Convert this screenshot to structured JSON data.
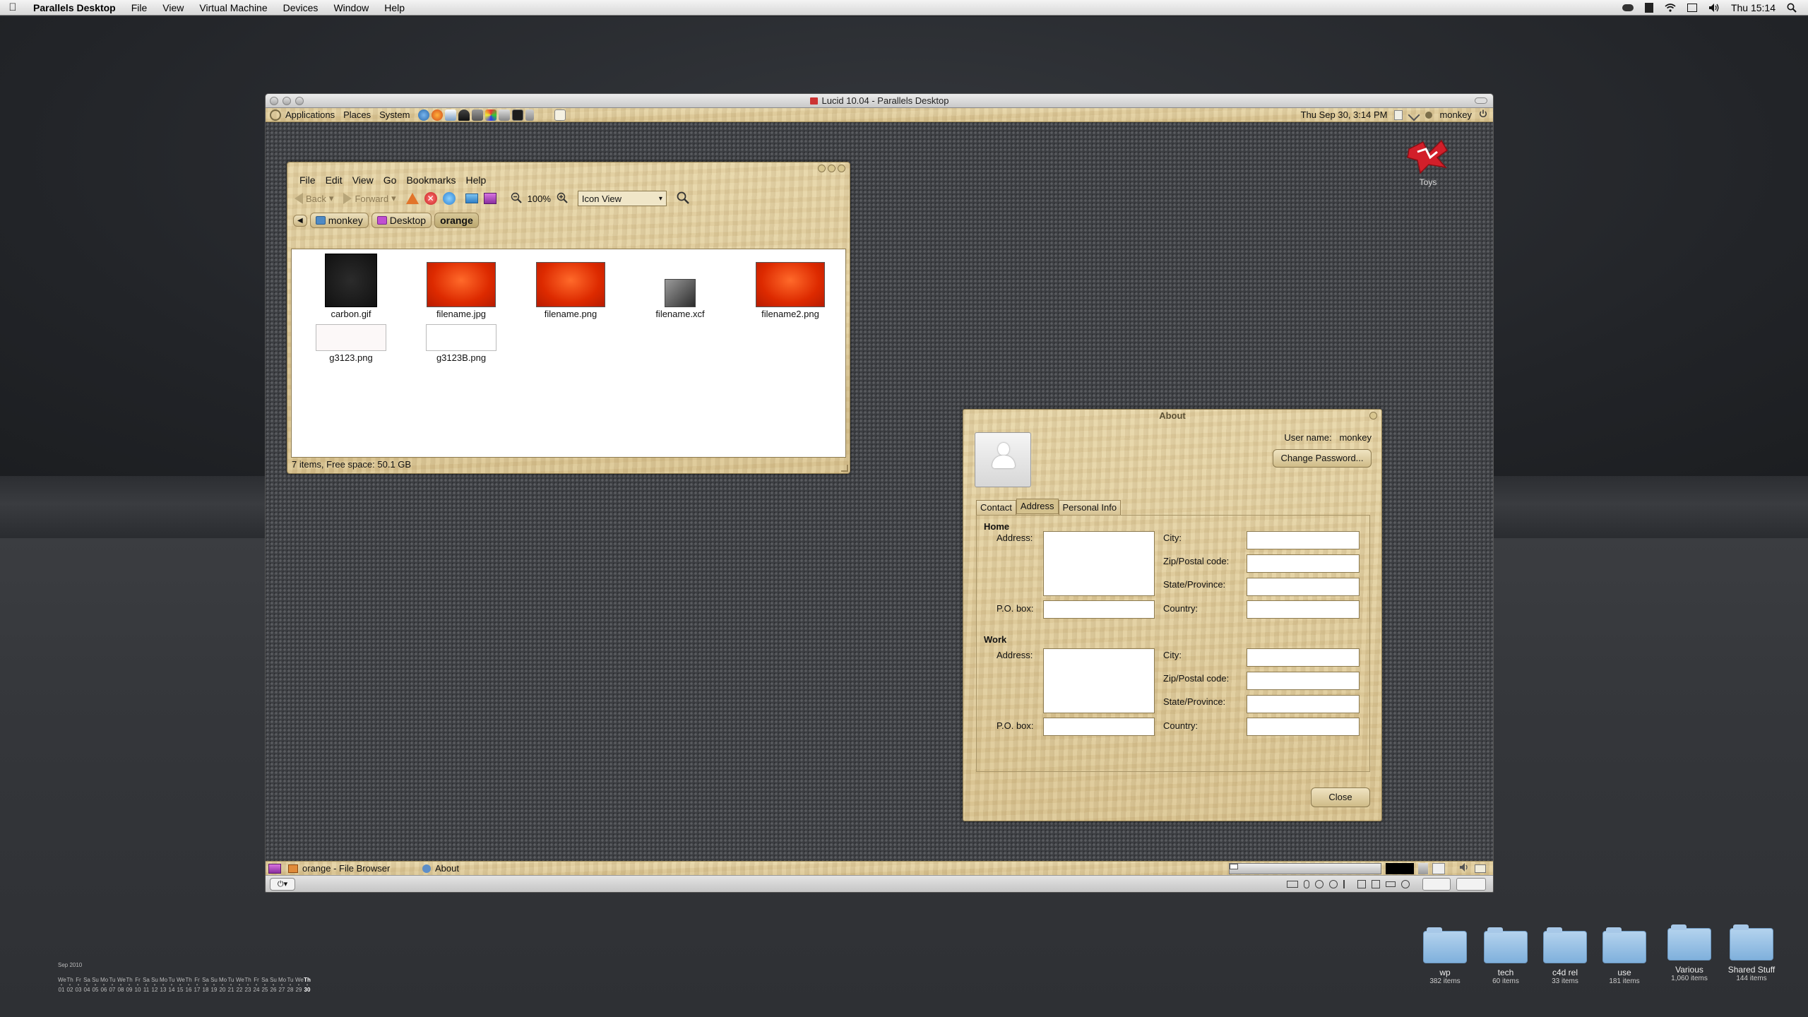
{
  "menubar": {
    "app_name": "Parallels Desktop",
    "items": [
      "File",
      "View",
      "Virtual Machine",
      "Devices",
      "Window",
      "Help"
    ],
    "clock": "Thu 15:14"
  },
  "parallels_window": {
    "title": "Lucid 10.04 - Parallels Desktop"
  },
  "gnome_panel": {
    "menus": [
      "Applications",
      "Places",
      "System"
    ],
    "datetime": "Thu Sep 30,  3:14 PM",
    "user": "monkey"
  },
  "desktop_icon": {
    "label": "Toys"
  },
  "file_browser": {
    "menu": [
      "File",
      "Edit",
      "View",
      "Go",
      "Bookmarks",
      "Help"
    ],
    "toolbar": {
      "back": "Back",
      "forward": "Forward",
      "zoom": "100%",
      "view_mode": "Icon View"
    },
    "breadcrumbs": [
      "monkey",
      "Desktop",
      "orange"
    ],
    "files": [
      {
        "name": "carbon.gif",
        "kind": "dark"
      },
      {
        "name": "filename.jpg",
        "kind": "red"
      },
      {
        "name": "filename.png",
        "kind": "red"
      },
      {
        "name": "filename.xcf",
        "kind": "xcf"
      },
      {
        "name": "filename2.png",
        "kind": "red"
      },
      {
        "name": "g3123.png",
        "kind": "light"
      },
      {
        "name": "g3123B.png",
        "kind": "light"
      }
    ],
    "status": "7 items, Free space: 50.1 GB"
  },
  "about_dialog": {
    "title": "About",
    "user_name_label": "User name:",
    "user_name": "monkey",
    "change_password": "Change Password...",
    "tabs": [
      "Contact",
      "Address",
      "Personal Info"
    ],
    "active_tab": "Address",
    "home_heading": "Home",
    "work_heading": "Work",
    "labels": {
      "address": "Address:",
      "po_box": "P.O. box:",
      "city": "City:",
      "zip": "Zip/Postal code:",
      "state": "State/Province:",
      "country": "Country:"
    },
    "close": "Close"
  },
  "taskbar": {
    "tasks": [
      "orange - File Browser",
      "About"
    ]
  },
  "mac_folders": [
    {
      "name": "wp",
      "count": "382 items"
    },
    {
      "name": "tech",
      "count": "60 items"
    },
    {
      "name": "c4d rel",
      "count": "33 items"
    },
    {
      "name": "use",
      "count": "181 items"
    },
    {
      "name": "Various",
      "count": "1,060 items"
    },
    {
      "name": "Shared Stuff",
      "count": "144 items"
    }
  ],
  "calendar": {
    "month": "Sep 2010",
    "days": [
      "We",
      "Th",
      "Fr",
      "Sa",
      "Su",
      "Mo",
      "Tu",
      "We",
      "Th",
      "Fr",
      "Sa",
      "Su",
      "Mo",
      "Tu",
      "We",
      "Th",
      "Fr",
      "Sa",
      "Su",
      "Mo",
      "Tu",
      "We",
      "Th",
      "Fr",
      "Sa",
      "Su",
      "Mo",
      "Tu",
      "We",
      "Th"
    ],
    "dates": [
      "01",
      "02",
      "03",
      "04",
      "05",
      "06",
      "07",
      "08",
      "09",
      "10",
      "11",
      "12",
      "13",
      "14",
      "15",
      "16",
      "17",
      "18",
      "19",
      "20",
      "21",
      "22",
      "23",
      "24",
      "25",
      "26",
      "27",
      "28",
      "29",
      "30"
    ]
  },
  "colors": {
    "wood": "#dcc795",
    "accent_red": "#e03a10"
  }
}
